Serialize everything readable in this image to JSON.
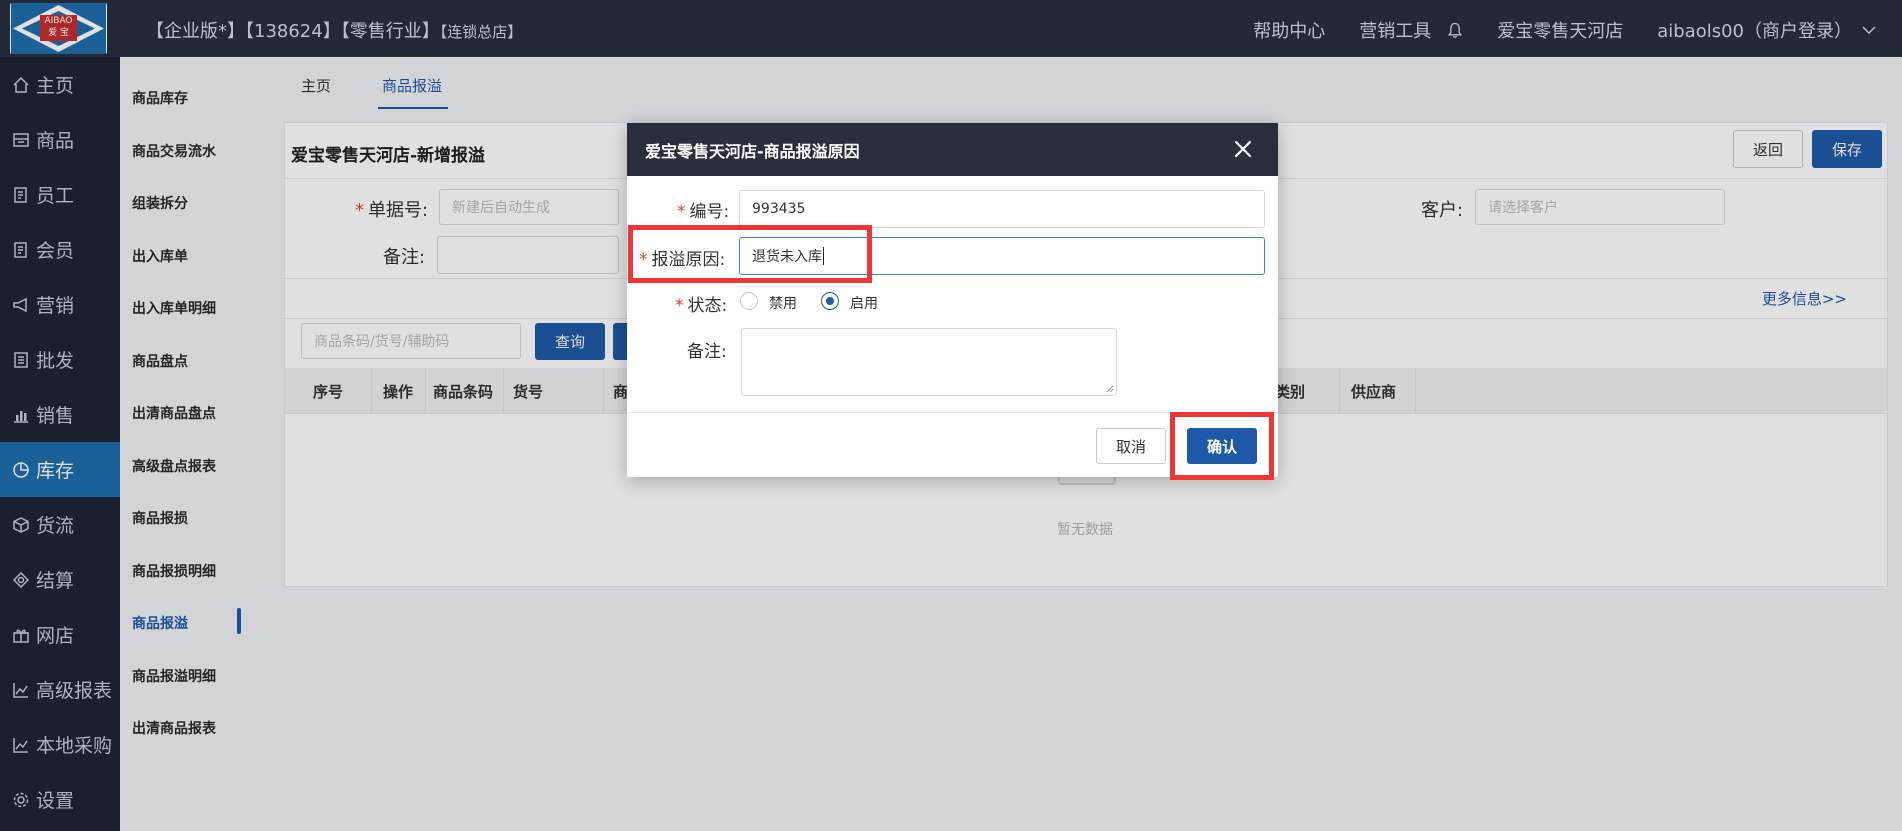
{
  "topbar": {
    "logo_text_top": "AIBAO",
    "logo_text_bottom": "爱 宝",
    "title_main": "【企业版*】【138624】【零售行业】",
    "title_small": "【连锁总店】",
    "help": "帮助中心",
    "marketing_tools": "营销工具",
    "store": "爱宝零售天河店",
    "user": "aibaols00（商户登录）"
  },
  "sidebar": {
    "items": [
      {
        "label": "主页",
        "icon": "home-icon"
      },
      {
        "label": "商品",
        "icon": "goods-icon"
      },
      {
        "label": "员工",
        "icon": "employee-icon"
      },
      {
        "label": "会员",
        "icon": "member-icon"
      },
      {
        "label": "营销",
        "icon": "megaphone-icon"
      },
      {
        "label": "批发",
        "icon": "wholesale-icon"
      },
      {
        "label": "销售",
        "icon": "sales-chart-icon"
      },
      {
        "label": "库存",
        "icon": "pie-chart-icon"
      },
      {
        "label": "货流",
        "icon": "cube-icon"
      },
      {
        "label": "结算",
        "icon": "settle-icon"
      },
      {
        "label": "网店",
        "icon": "gift-icon"
      },
      {
        "label": "高级报表",
        "icon": "line-chart-icon"
      },
      {
        "label": "本地采购",
        "icon": "line-chart-icon"
      },
      {
        "label": "设置",
        "icon": "gear-icon"
      }
    ],
    "active_index": 7
  },
  "subnav": {
    "items": [
      "商品库存",
      "商品交易流水",
      "组装拆分",
      "出入库单",
      "出入库单明细",
      "商品盘点",
      "出清商品盘点",
      "高级盘点报表",
      "商品报损",
      "商品报损明细",
      "商品报溢",
      "商品报溢明细",
      "出清商品报表"
    ],
    "active_index": 10
  },
  "tabs": {
    "home": "主页",
    "current": "商品报溢"
  },
  "panel": {
    "title": "爱宝零售天河店-新增报溢",
    "back_label": "返回",
    "save_label": "保存",
    "doc_no_label": "单据号:",
    "doc_no_placeholder": "新建后自动生成",
    "remark_label": "备注:",
    "customer_label": "客户:",
    "customer_placeholder": "请选择客户",
    "more_info": "更多信息>>",
    "search_placeholder": "商品条码/货号/辅助码",
    "query_label": "查询",
    "columns": [
      "序号",
      "操作",
      "商品条码",
      "货号",
      "商",
      "类别",
      "供应商"
    ],
    "empty_text": "暂无数据"
  },
  "modal": {
    "title": "爱宝零售天河店-商品报溢原因",
    "code_label": "编号:",
    "code_value": "993435",
    "reason_label": "报溢原因:",
    "reason_value": "退货未入库",
    "status_label": "状态:",
    "status_disabled": "禁用",
    "status_enabled": "启用",
    "status_selected": "启用",
    "remark_label": "备注:",
    "cancel_label": "取消",
    "confirm_label": "确认"
  },
  "colors": {
    "accent": "#1e5aa8",
    "topbar": "#2a2f3e",
    "sidebar": "#1f2535",
    "active_menu": "#1d6fae",
    "highlight": "#ee3636"
  }
}
